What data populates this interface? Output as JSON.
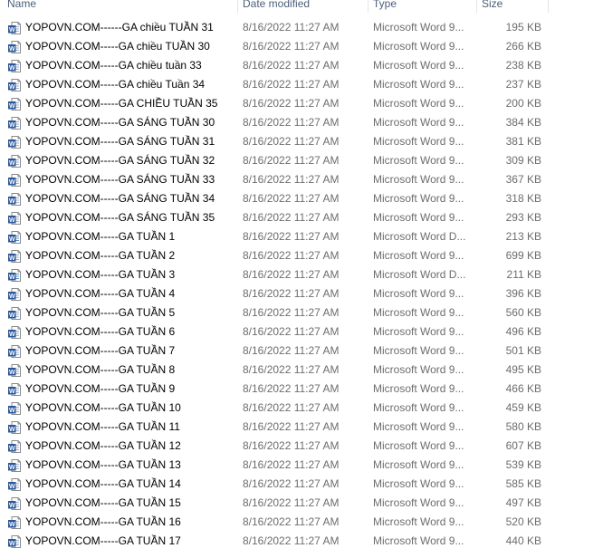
{
  "columns": {
    "name": "Name",
    "date": "Date modified",
    "type": "Type",
    "size": "Size"
  },
  "files": [
    {
      "name": "YOPOVN.COM------GA chiều  TUẦN 31",
      "date": "8/16/2022 11:27 AM",
      "type": "Microsoft Word 9...",
      "size": "195 KB",
      "icon": "word-97-icon"
    },
    {
      "name": "YOPOVN.COM-----GA chiều TUẦN 30",
      "date": "8/16/2022 11:27 AM",
      "type": "Microsoft Word 9...",
      "size": "266 KB",
      "icon": "word-97-icon"
    },
    {
      "name": "YOPOVN.COM-----GA chiều tuần 33",
      "date": "8/16/2022 11:27 AM",
      "type": "Microsoft Word 9...",
      "size": "238 KB",
      "icon": "word-97-icon"
    },
    {
      "name": "YOPOVN.COM-----GA chiều Tuần 34",
      "date": "8/16/2022 11:27 AM",
      "type": "Microsoft Word 9...",
      "size": "237 KB",
      "icon": "word-97-icon"
    },
    {
      "name": "YOPOVN.COM-----GA CHIỀU TUẦN 35",
      "date": "8/16/2022 11:27 AM",
      "type": "Microsoft Word 9...",
      "size": "200 KB",
      "icon": "word-97-icon"
    },
    {
      "name": "YOPOVN.COM-----GA SÁNG TUẦN 30",
      "date": "8/16/2022 11:27 AM",
      "type": "Microsoft Word 9...",
      "size": "384 KB",
      "icon": "word-97-icon"
    },
    {
      "name": "YOPOVN.COM-----GA SÁNG TUẦN 31",
      "date": "8/16/2022 11:27 AM",
      "type": "Microsoft Word 9...",
      "size": "381 KB",
      "icon": "word-97-icon"
    },
    {
      "name": "YOPOVN.COM-----GA SÁNG TUẦN 32",
      "date": "8/16/2022 11:27 AM",
      "type": "Microsoft Word 9...",
      "size": "309 KB",
      "icon": "word-97-icon"
    },
    {
      "name": "YOPOVN.COM-----GA SÁNG TUẦN 33",
      "date": "8/16/2022 11:27 AM",
      "type": "Microsoft Word 9...",
      "size": "367 KB",
      "icon": "word-97-icon"
    },
    {
      "name": "YOPOVN.COM-----GA SÁNG TUẦN 34",
      "date": "8/16/2022 11:27 AM",
      "type": "Microsoft Word 9...",
      "size": "318 KB",
      "icon": "word-97-icon"
    },
    {
      "name": "YOPOVN.COM-----GA SÁNG TUẦN 35",
      "date": "8/16/2022 11:27 AM",
      "type": "Microsoft Word 9...",
      "size": "293 KB",
      "icon": "word-97-icon"
    },
    {
      "name": "YOPOVN.COM-----GA TUẦN 1",
      "date": "8/16/2022 11:27 AM",
      "type": "Microsoft Word D...",
      "size": "213 KB",
      "icon": "word-docx-icon"
    },
    {
      "name": "YOPOVN.COM-----GA TUẦN 2",
      "date": "8/16/2022 11:27 AM",
      "type": "Microsoft Word 9...",
      "size": "699 KB",
      "icon": "word-97-icon"
    },
    {
      "name": "YOPOVN.COM-----GA TUẦN 3",
      "date": "8/16/2022 11:27 AM",
      "type": "Microsoft Word D...",
      "size": "211 KB",
      "icon": "word-docx-icon"
    },
    {
      "name": "YOPOVN.COM-----GA TUẦN 4",
      "date": "8/16/2022 11:27 AM",
      "type": "Microsoft Word 9...",
      "size": "396 KB",
      "icon": "word-97-icon"
    },
    {
      "name": "YOPOVN.COM-----GA TUẦN 5",
      "date": "8/16/2022 11:27 AM",
      "type": "Microsoft Word 9...",
      "size": "560 KB",
      "icon": "word-97-icon"
    },
    {
      "name": "YOPOVN.COM-----GA TUẦN 6",
      "date": "8/16/2022 11:27 AM",
      "type": "Microsoft Word 9...",
      "size": "496 KB",
      "icon": "word-97-icon"
    },
    {
      "name": "YOPOVN.COM-----GA TUẦN 7",
      "date": "8/16/2022 11:27 AM",
      "type": "Microsoft Word 9...",
      "size": "501 KB",
      "icon": "word-97-icon"
    },
    {
      "name": "YOPOVN.COM-----GA TUẦN 8",
      "date": "8/16/2022 11:27 AM",
      "type": "Microsoft Word 9...",
      "size": "495 KB",
      "icon": "word-97-icon"
    },
    {
      "name": "YOPOVN.COM-----GA TUẦN 9",
      "date": "8/16/2022 11:27 AM",
      "type": "Microsoft Word 9...",
      "size": "466 KB",
      "icon": "word-97-icon"
    },
    {
      "name": "YOPOVN.COM-----GA TUẦN 10",
      "date": "8/16/2022 11:27 AM",
      "type": "Microsoft Word 9...",
      "size": "459 KB",
      "icon": "word-97-icon"
    },
    {
      "name": "YOPOVN.COM-----GA TUẦN 11",
      "date": "8/16/2022 11:27 AM",
      "type": "Microsoft Word 9...",
      "size": "580 KB",
      "icon": "word-97-icon"
    },
    {
      "name": "YOPOVN.COM-----GA TUẦN 12",
      "date": "8/16/2022 11:27 AM",
      "type": "Microsoft Word 9...",
      "size": "607 KB",
      "icon": "word-97-icon"
    },
    {
      "name": "YOPOVN.COM-----GA TUẦN 13",
      "date": "8/16/2022 11:27 AM",
      "type": "Microsoft Word 9...",
      "size": "539 KB",
      "icon": "word-97-icon"
    },
    {
      "name": "YOPOVN.COM-----GA TUẦN 14",
      "date": "8/16/2022 11:27 AM",
      "type": "Microsoft Word 9...",
      "size": "585 KB",
      "icon": "word-97-icon"
    },
    {
      "name": "YOPOVN.COM-----GA TUẦN 15",
      "date": "8/16/2022 11:27 AM",
      "type": "Microsoft Word 9...",
      "size": "497 KB",
      "icon": "word-97-icon"
    },
    {
      "name": "YOPOVN.COM-----GA TUẦN 16",
      "date": "8/16/2022 11:27 AM",
      "type": "Microsoft Word 9...",
      "size": "520 KB",
      "icon": "word-97-icon"
    },
    {
      "name": "YOPOVN.COM-----GA TUẦN 17",
      "date": "8/16/2022 11:27 AM",
      "type": "Microsoft Word 9...",
      "size": "440 KB",
      "icon": "word-97-icon"
    }
  ],
  "colors": {
    "word_blue": "#2b579a",
    "header_text": "#4c607a",
    "detail_text": "#6d6d6d"
  }
}
